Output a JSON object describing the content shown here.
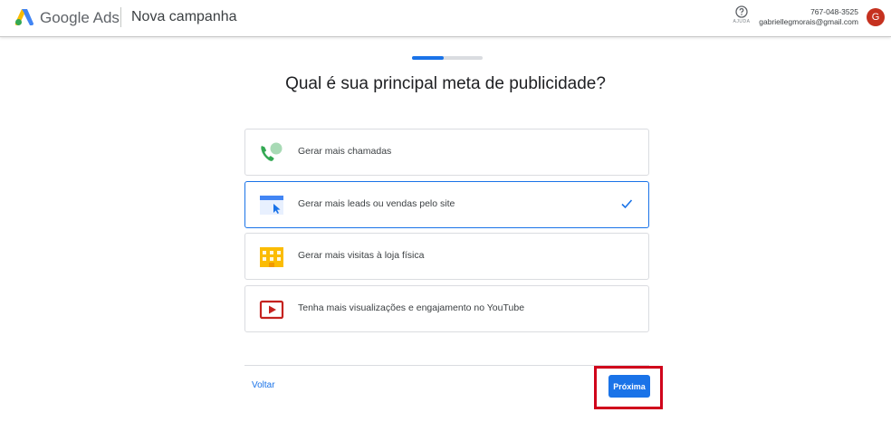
{
  "header": {
    "brand": "Google Ads",
    "page_title": "Nova campanha",
    "help_label": "AJUDA",
    "account_id": "767-048-3525",
    "account_email": "gabriellegmorais@gmail.com",
    "avatar_letter": "G"
  },
  "progress": {
    "value_fraction": 0.45
  },
  "question": "Qual é sua principal meta de publicidade?",
  "options": [
    {
      "label": "Gerar mais chamadas",
      "icon": "phone-icon",
      "selected": false
    },
    {
      "label": "Gerar mais leads ou vendas pelo site",
      "icon": "website-icon",
      "selected": true
    },
    {
      "label": "Gerar mais visitas à loja física",
      "icon": "store-icon",
      "selected": false
    },
    {
      "label": "Tenha mais visualizações e engajamento no YouTube",
      "icon": "youtube-icon",
      "selected": false
    }
  ],
  "footer": {
    "back_label": "Voltar",
    "next_label": "Próxima"
  },
  "colors": {
    "accent": "#1a73e8",
    "highlight": "#d0021b",
    "avatar": "#c5311f"
  }
}
